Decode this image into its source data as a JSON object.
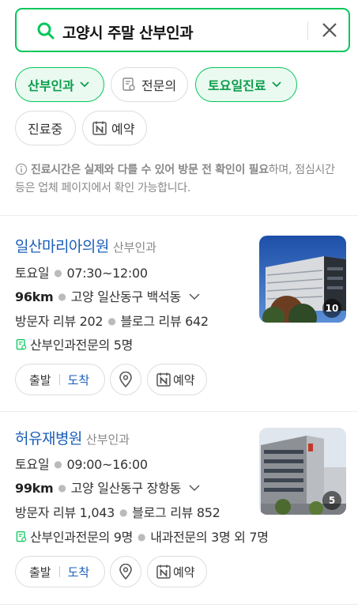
{
  "search": {
    "query": "고양시 주말 산부인과"
  },
  "filters": {
    "chips": [
      {
        "label": "산부인과",
        "active": true
      },
      {
        "label": "전문의",
        "active": false
      },
      {
        "label": "토요일진료",
        "active": true
      },
      {
        "label": "진료중",
        "active": false
      },
      {
        "label": "예약",
        "active": false
      }
    ]
  },
  "notice": {
    "bold": "진료시간은 실제와 다를 수 있어 방문 전 확인이 필요",
    "rest": "하며, 점심시간 등은 업체 페이지에서 확인 가능합니다."
  },
  "results": [
    {
      "name": "일산마리아의원",
      "category": "산부인과",
      "day": "토요일",
      "hours": "07:30~12:00",
      "distance": "96km",
      "address": "고양 일산동구 백석동",
      "visitor_reviews": "방문자 리뷰 202",
      "blog_reviews": "블로그 리뷰 642",
      "specialists": [
        "산부인과전문의 5명"
      ],
      "photo_count": "10",
      "depart_label": "출발",
      "arrive_label": "도착",
      "reserve_label": "예약"
    },
    {
      "name": "허유재병원",
      "category": "산부인과",
      "day": "토요일",
      "hours": "09:00~16:00",
      "distance": "99km",
      "address": "고양 일산동구 장항동",
      "visitor_reviews": "방문자 리뷰 1,043",
      "blog_reviews": "블로그 리뷰 852",
      "specialists": [
        "산부인과전문의 9명",
        "내과전문의 3명 외 7명"
      ],
      "photo_count": "5",
      "depart_label": "출발",
      "arrive_label": "도착",
      "reserve_label": "예약"
    }
  ],
  "colors": {
    "accent": "#03c75a",
    "link": "#1a5fb8"
  },
  "icons": [
    "search-icon",
    "close-icon",
    "certificate-icon",
    "naver-n-icon",
    "info-icon",
    "location-pin-icon",
    "chevron-down-icon"
  ]
}
